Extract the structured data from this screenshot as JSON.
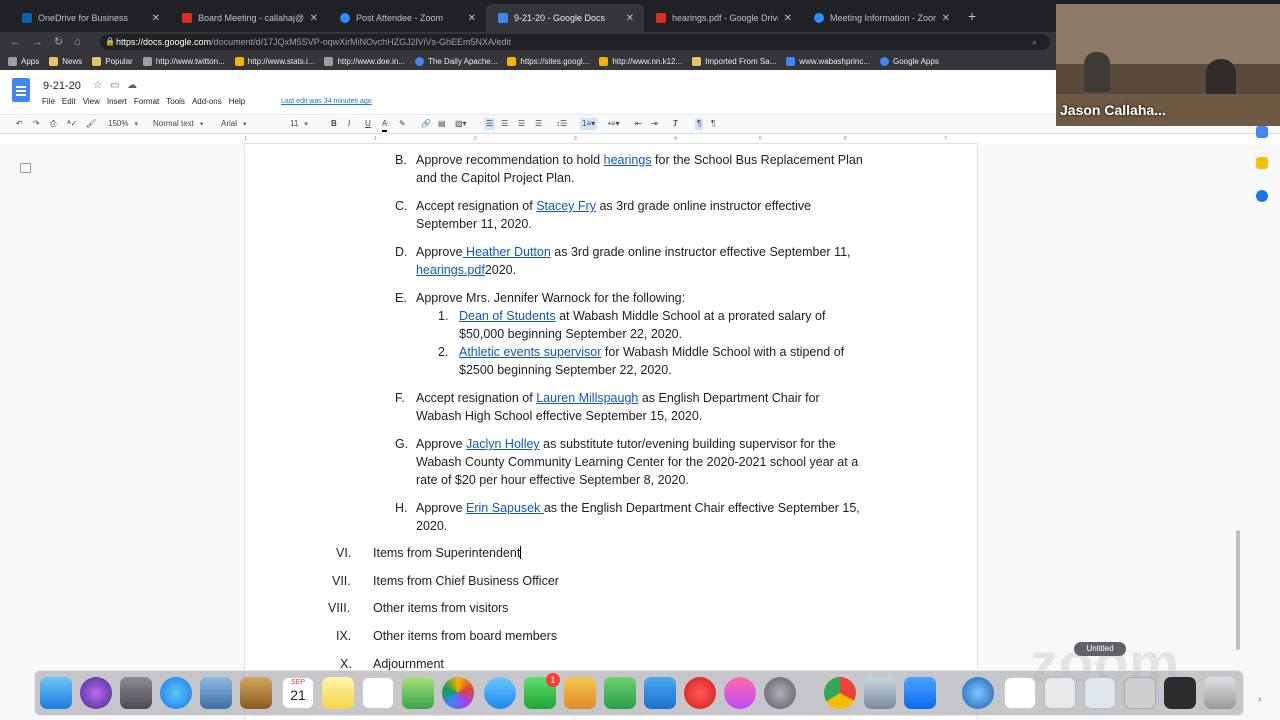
{
  "browser": {
    "tabs": [
      {
        "title": "OneDrive for Business",
        "color": "#0364b8"
      },
      {
        "title": "Board Meeting - callahaj@ap",
        "color": "#d93025"
      },
      {
        "title": "Post Attendee - Zoom",
        "color": "#2d8cff"
      },
      {
        "title": "9-21-20 - Google Docs",
        "color": "#4285f4"
      },
      {
        "title": "hearings.pdf - Google Drive",
        "color": "#d93025"
      },
      {
        "title": "Meeting Information - Zoom",
        "color": "#2d8cff"
      }
    ],
    "new_tab": "+",
    "url_host": "https://docs.google.com",
    "url_path": "/document/d/17JQxM5SVP-oqwXirMiNOvchHZGJ2lViVs-GhEEm5NXA/edit",
    "bookmarks": [
      {
        "label": "Apps",
        "color": "#9aa0a6"
      },
      {
        "label": "News",
        "color": "#e8c36a"
      },
      {
        "label": "Popular",
        "color": "#e8c36a"
      },
      {
        "label": "http://www.twitton...",
        "color": "#9aa0a6"
      },
      {
        "label": "http://www.stats.i...",
        "color": "#f4b400"
      },
      {
        "label": "http://www.doe.in...",
        "color": "#9aa0a6"
      },
      {
        "label": "The Daily Apache...",
        "color": "#4285f4"
      },
      {
        "label": "https://sites.googl...",
        "color": "#f4b400"
      },
      {
        "label": "http://www.nn.k12...",
        "color": "#f4b400"
      },
      {
        "label": "Imported From Sa...",
        "color": "#e8c36a"
      },
      {
        "label": "www.wabashprinc...",
        "color": "#4285f4"
      },
      {
        "label": "Google Apps",
        "color": "#4285f4"
      }
    ]
  },
  "docs": {
    "title": "9-21-20",
    "menu": [
      "File",
      "Edit",
      "View",
      "Insert",
      "Format",
      "Tools",
      "Add-ons",
      "Help"
    ],
    "last_edit": "Last edit was 34 minutes ago",
    "toolbar": {
      "zoom": "150%",
      "style": "Normal text",
      "font": "Arial",
      "size": "11",
      "bold": "B",
      "italic": "I",
      "underline": "U",
      "text_color": "A"
    },
    "ruler_marks": [
      "1",
      "1",
      "2",
      "3",
      "4",
      "5",
      "6",
      "7"
    ]
  },
  "content": {
    "B_label": "B.",
    "B_pre": "Approve recommendation to hold ",
    "B_link": "hearings",
    "B_post": " for the School Bus Replacement Plan",
    "B_line2": "and the Capitol Project Plan.",
    "C_label": "C.",
    "C_pre": "Accept resignation of ",
    "C_link": "Stacey Fry",
    "C_post": " as 3rd grade online instructor effective",
    "C_line2": "September 11, 2020.",
    "D_label": "D.",
    "D_pre": "Approve",
    "D_link": " Heather Dutton",
    "D_post": " as 3rd grade online instructor effective September 11,",
    "D_link2": "hearings.pdf",
    "D_post2": "2020.",
    "E_label": "E.",
    "E_text": "Approve Mrs. Jennifer Warnock for the following:",
    "E1_label": "1.",
    "E1_link": "Dean of Students",
    "E1_post": " at Wabash Middle School at a prorated salary of",
    "E1_line2": "$50,000 beginning September 22, 2020.",
    "E2_label": "2.",
    "E2_link": "Athletic events supervisor",
    "E2_post": " for Wabash Middle School with a stipend of",
    "E2_line2": "$2500 beginning September 22, 2020.",
    "F_label": "F.",
    "F_pre": "Accept resignation of ",
    "F_link": "Lauren Millspaugh",
    "F_post": " as English Department Chair for",
    "F_line2": "Wabash High School effective September 15, 2020.",
    "G_label": "G.",
    "G_pre": "Approve ",
    "G_link": "Jaclyn Holley",
    "G_post": " as substitute tutor/evening building supervisor for the",
    "G_line2": "Wabash County Community Learning Center for the 2020-2021 school year at a",
    "G_line3": "rate of $20 per hour effective September 8, 2020.",
    "H_label": "H.",
    "H_pre": "Approve ",
    "H_link": "Erin Sapusek ",
    "H_post": "as the English Department Chair effective September 15,",
    "H_line2": "2020.",
    "VI_label": "VI.",
    "VI_text": "Items from Superintendent",
    "VII_label": "VII.",
    "VII_text": "Items from Chief Business Officer",
    "VIII_label": "VIII.",
    "VIII_text": "Other items from visitors",
    "IX_label": "IX.",
    "IX_text": "Other items from board members",
    "X_label": "X.",
    "X_text": "Adjournment"
  },
  "video": {
    "participant_name": "Jason Callaha..."
  },
  "zoom": {
    "watermark": "zoom",
    "window_label": "Untitled"
  },
  "dock": {
    "calendar_month": "SEP",
    "calendar_day": "21",
    "badge_count": "1"
  }
}
